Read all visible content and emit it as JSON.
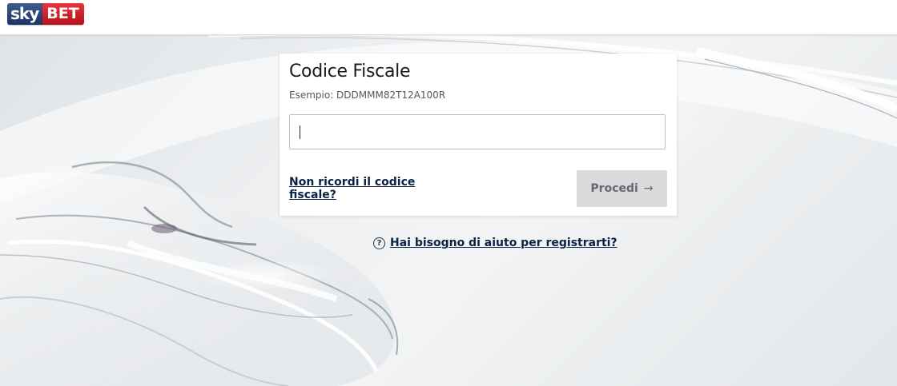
{
  "header": {
    "logo": {
      "part1": "sky",
      "part2": "BET"
    }
  },
  "card": {
    "title": "Codice Fiscale",
    "hint": "Esempio: DDDMMM82T12A100R",
    "input_value": "",
    "forgot_link": "Non ricordi il codice fiscale?",
    "proceed_label": "Procedi",
    "proceed_icon": "→"
  },
  "help": {
    "icon": "?",
    "link": "Hai bisogno di aiuto per registrarti?"
  },
  "colors": {
    "brand_blue": "#1d3466",
    "brand_red": "#c8102e",
    "link": "#0a2244",
    "button_disabled": "#d9dadc"
  }
}
